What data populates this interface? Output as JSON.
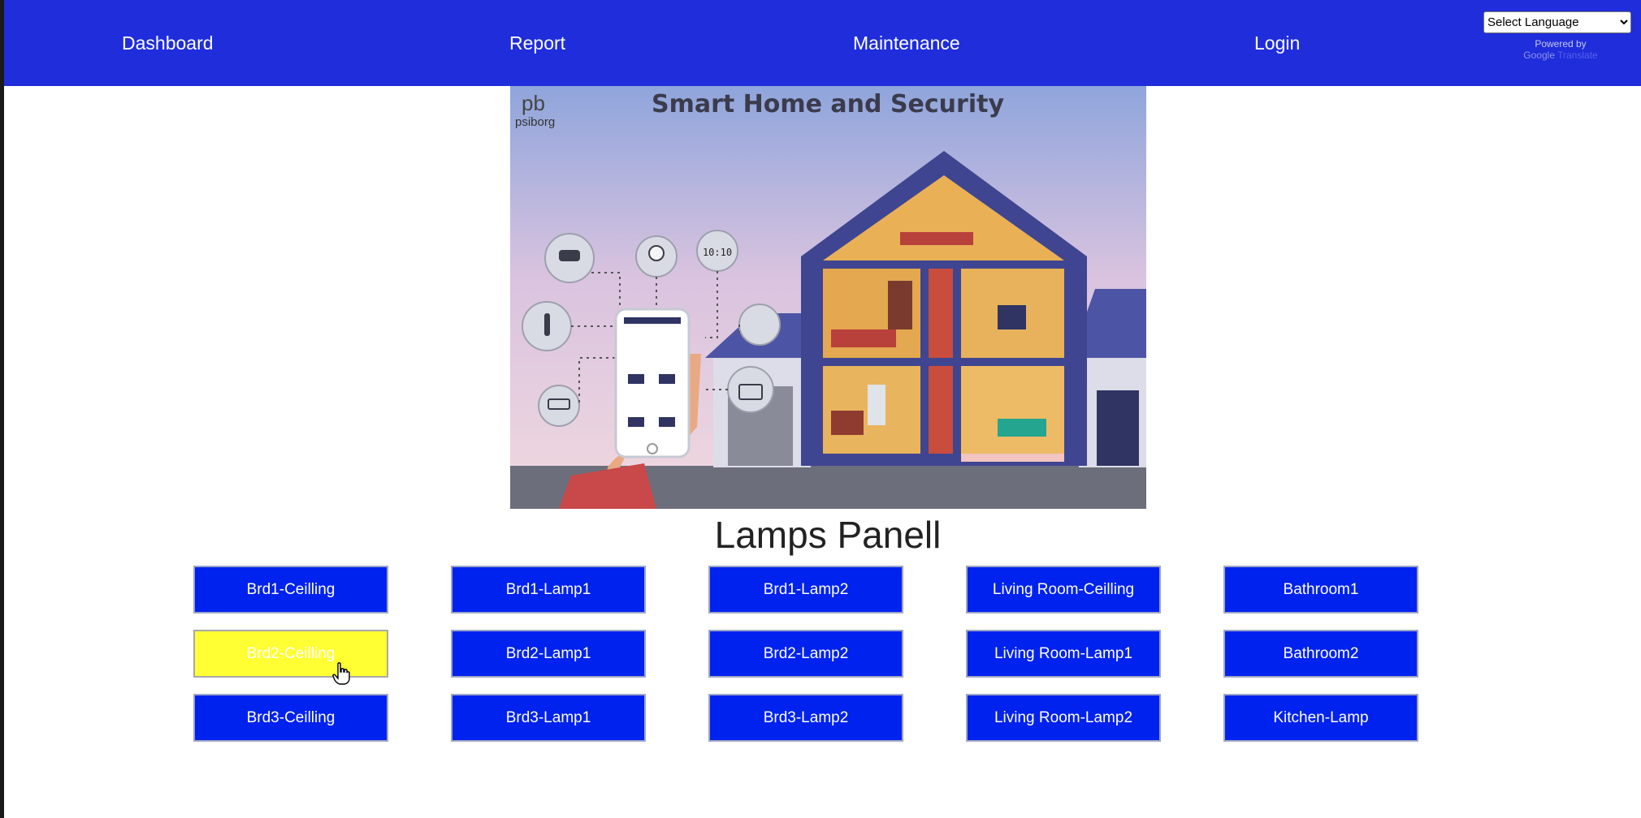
{
  "nav": {
    "links": [
      "Dashboard",
      "Report",
      "Maintenance",
      "Login"
    ]
  },
  "translate": {
    "select_label": "Select Language",
    "powered_by": "Powered by",
    "google": "Google",
    "translate": "Translate"
  },
  "banner": {
    "title": "Smart Home and Security",
    "logo_mark": "pb",
    "logo_text": "psiborg",
    "clock": "10:10"
  },
  "panel": {
    "title": "Lamps Panell",
    "lamps": [
      {
        "label": "Brd1-Ceilling",
        "active": false
      },
      {
        "label": "Brd1-Lamp1",
        "active": false
      },
      {
        "label": "Brd1-Lamp2",
        "active": false
      },
      {
        "label": "Living Room-Ceilling",
        "active": false
      },
      {
        "label": "Bathroom1",
        "active": false
      },
      {
        "label": "Brd2-Ceilling",
        "active": true
      },
      {
        "label": "Brd2-Lamp1",
        "active": false
      },
      {
        "label": "Brd2-Lamp2",
        "active": false
      },
      {
        "label": "Living Room-Lamp1",
        "active": false
      },
      {
        "label": "Bathroom2",
        "active": false
      },
      {
        "label": "Brd3-Ceilling",
        "active": false
      },
      {
        "label": "Brd3-Lamp1",
        "active": false
      },
      {
        "label": "Brd3-Lamp2",
        "active": false
      },
      {
        "label": "Living Room-Lamp2",
        "active": false
      },
      {
        "label": "Kitchen-Lamp",
        "active": false
      }
    ]
  },
  "colors": {
    "navbar": "#1f2ddb",
    "button": "#0022ee",
    "button_active": "#ffff33"
  }
}
